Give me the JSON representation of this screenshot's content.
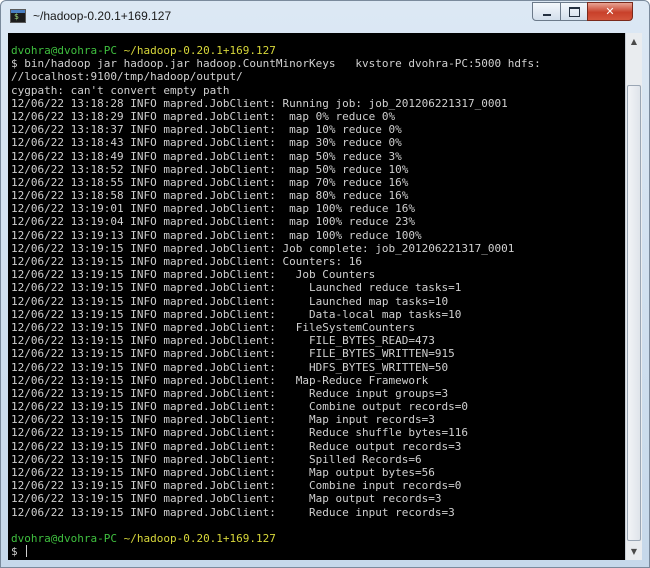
{
  "window": {
    "title": "~/hadoop-0.20.1+169.127",
    "minimize_glyph": "minimize",
    "maximize_glyph": "maximize",
    "close_glyph": "✕"
  },
  "console": {
    "first_prompt": {
      "user": "dvohra@dvohra-PC",
      "path": "~/hadoop-0.20.1+169.127"
    },
    "lines": [
      "$ bin/hadoop jar hadoop.jar hadoop.CountMinorKeys   kvstore dvohra-PC:5000 hdfs:",
      "//localhost:9100/tmp/hadoop/output/",
      "cygpath: can't convert empty path",
      "12/06/22 13:18:28 INFO mapred.JobClient: Running job: job_201206221317_0001",
      "12/06/22 13:18:29 INFO mapred.JobClient:  map 0% reduce 0%",
      "12/06/22 13:18:37 INFO mapred.JobClient:  map 10% reduce 0%",
      "12/06/22 13:18:43 INFO mapred.JobClient:  map 30% reduce 0%",
      "12/06/22 13:18:49 INFO mapred.JobClient:  map 50% reduce 3%",
      "12/06/22 13:18:52 INFO mapred.JobClient:  map 50% reduce 10%",
      "12/06/22 13:18:55 INFO mapred.JobClient:  map 70% reduce 16%",
      "12/06/22 13:18:58 INFO mapred.JobClient:  map 80% reduce 16%",
      "12/06/22 13:19:01 INFO mapred.JobClient:  map 100% reduce 16%",
      "12/06/22 13:19:04 INFO mapred.JobClient:  map 100% reduce 23%",
      "12/06/22 13:19:13 INFO mapred.JobClient:  map 100% reduce 100%",
      "12/06/22 13:19:15 INFO mapred.JobClient: Job complete: job_201206221317_0001",
      "12/06/22 13:19:15 INFO mapred.JobClient: Counters: 16",
      "12/06/22 13:19:15 INFO mapred.JobClient:   Job Counters",
      "12/06/22 13:19:15 INFO mapred.JobClient:     Launched reduce tasks=1",
      "12/06/22 13:19:15 INFO mapred.JobClient:     Launched map tasks=10",
      "12/06/22 13:19:15 INFO mapred.JobClient:     Data-local map tasks=10",
      "12/06/22 13:19:15 INFO mapred.JobClient:   FileSystemCounters",
      "12/06/22 13:19:15 INFO mapred.JobClient:     FILE_BYTES_READ=473",
      "12/06/22 13:19:15 INFO mapred.JobClient:     FILE_BYTES_WRITTEN=915",
      "12/06/22 13:19:15 INFO mapred.JobClient:     HDFS_BYTES_WRITTEN=50",
      "12/06/22 13:19:15 INFO mapred.JobClient:   Map-Reduce Framework",
      "12/06/22 13:19:15 INFO mapred.JobClient:     Reduce input groups=3",
      "12/06/22 13:19:15 INFO mapred.JobClient:     Combine output records=0",
      "12/06/22 13:19:15 INFO mapred.JobClient:     Map input records=3",
      "12/06/22 13:19:15 INFO mapred.JobClient:     Reduce shuffle bytes=116",
      "12/06/22 13:19:15 INFO mapred.JobClient:     Reduce output records=3",
      "12/06/22 13:19:15 INFO mapred.JobClient:     Spilled Records=6",
      "12/06/22 13:19:15 INFO mapred.JobClient:     Map output bytes=56",
      "12/06/22 13:19:15 INFO mapred.JobClient:     Combine input records=0",
      "12/06/22 13:19:15 INFO mapred.JobClient:     Map output records=3",
      "12/06/22 13:19:15 INFO mapred.JobClient:     Reduce input records=3"
    ],
    "last_prompt": {
      "user": "dvohra-PC",
      "path": "~/hadoop-0.20.1+169.127"
    },
    "input_prompt": "$ ",
    "input_value": ""
  },
  "scrollbar": {
    "up_arrow": "▲",
    "down_arrow": "▼"
  },
  "colors": {
    "background": "#000000",
    "text": "#d0d0d0",
    "prompt_user": "#3fbf3f",
    "prompt_path": "#d7d73a"
  }
}
